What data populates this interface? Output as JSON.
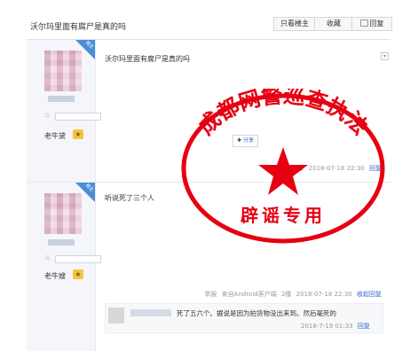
{
  "header": {
    "title": "沃尔玛里面有腐尸是真的吗",
    "only_op_label": "只看楼主",
    "favorite_label": "收藏",
    "reply_label": "回复"
  },
  "posts": [
    {
      "content": "沃尔玛里面有腐尸是真的吗",
      "username": "",
      "corner_label": "楼主",
      "meta": {
        "report": "",
        "source": "来自Android客户端",
        "floor": "1楼",
        "time": "2018-07-18 22:30",
        "action": "回复"
      }
    },
    {
      "content": "听说死了三个人",
      "username": "老牛嫂",
      "corner_label": "楼主",
      "meta": {
        "report": "举报",
        "source": "来自Android客户端",
        "floor": "2楼",
        "time": "2018-07-18 22:30",
        "action": "收起回复"
      },
      "subreply": {
        "text": "死了五六个。据说是因为拍货物没出来到。然后毫死的",
        "time": "2018-7-19 01:33",
        "action": "回复"
      }
    }
  ],
  "first_username": "老牛黛",
  "share_label": "分享",
  "stamp": {
    "top_text": "成都网警巡查执法",
    "bottom_text": "辟谣专用",
    "color": "#e60012"
  },
  "colors": {
    "accent": "#3366cc",
    "sidebar_bg": "#f4f6fb",
    "stamp_red": "#e60012"
  }
}
